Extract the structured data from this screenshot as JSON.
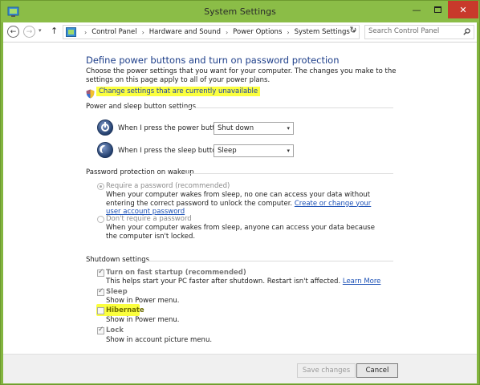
{
  "window": {
    "title": "System Settings",
    "minimize_label": "—",
    "close_label": "✕"
  },
  "addressbar": {
    "back": "←",
    "forward": "→",
    "dropdown": "▾",
    "up": "↑",
    "breadcrumbs": [
      "Control Panel",
      "Hardware and Sound",
      "Power Options",
      "System Settings"
    ],
    "separator": "›",
    "refresh": "↻",
    "search_placeholder": "Search Control Panel"
  },
  "page": {
    "heading": "Define power buttons and turn on password protection",
    "description": "Choose the power settings that you want for your computer. The changes you make to the settings on this page apply to all of your power plans.",
    "change_settings_link": "Change settings that are currently unavailable"
  },
  "power_buttons": {
    "group_title": "Power and sleep button settings",
    "power_label": "When I press the power button:",
    "power_value": "Shut down",
    "sleep_label": "When I press the sleep button:",
    "sleep_value": "Sleep"
  },
  "password": {
    "group_title": "Password protection on wakeup",
    "require_label": "Require a password (recommended)",
    "require_desc_1": "When your computer wakes from sleep, no one can access your data without entering the correct password to unlock the computer.",
    "require_link": "Create or change your user account password",
    "norequire_label": "Don't require a password",
    "norequire_desc": "When your computer wakes from sleep, anyone can access your data because the computer isn't locked."
  },
  "shutdown": {
    "group_title": "Shutdown settings",
    "fast_startup_label": "Turn on fast startup (recommended)",
    "fast_startup_desc": "This helps start your PC faster after shutdown. Restart isn't affected.",
    "learn_more": "Learn More",
    "sleep_label": "Sleep",
    "sleep_desc": "Show in Power menu.",
    "hibernate_label": "Hibernate",
    "hibernate_desc": "Show in Power menu.",
    "lock_label": "Lock",
    "lock_desc": "Show in account picture menu."
  },
  "footer": {
    "save_label": "Save changes",
    "cancel_label": "Cancel"
  },
  "colors": {
    "titlebar": "#8bbd47",
    "heading": "#1e3f8a",
    "highlight": "#fbff3e",
    "link": "#1a4fb5",
    "close": "#c8392b"
  }
}
